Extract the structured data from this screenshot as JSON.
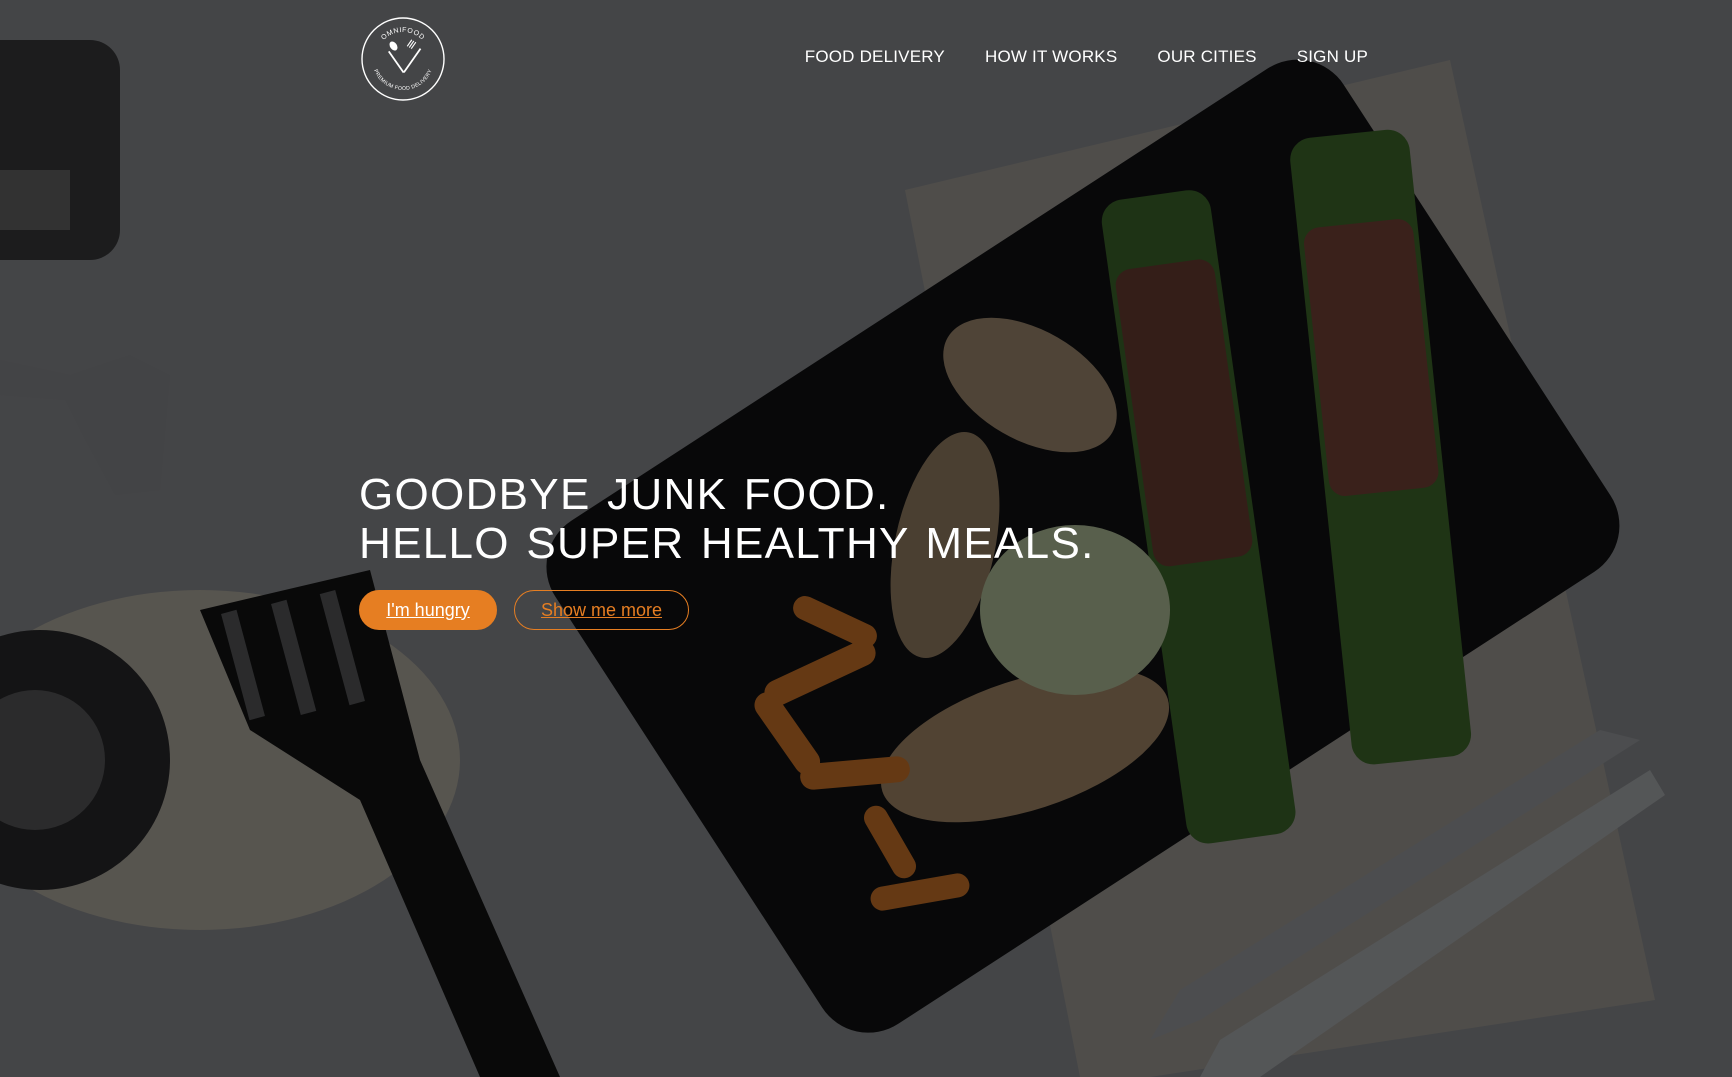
{
  "logo": {
    "brand_top": "OMNIFOOD",
    "brand_bottom": "PREMIUM FOOD DELIVERY",
    "icon": "spoon-fork-crossed-icon"
  },
  "nav": {
    "items": [
      {
        "label": "FOOD DELIVERY"
      },
      {
        "label": "HOW IT WORKS"
      },
      {
        "label": "OUR CITIES"
      },
      {
        "label": "SIGN UP"
      }
    ]
  },
  "hero": {
    "headline_line1": "GOODBYE JUNK FOOD.",
    "headline_line2": "HELLO SUPER HEALTHY MEALS.",
    "primary_button": "I'm hungry",
    "secondary_button": "Show me more"
  },
  "colors": {
    "accent": "#e67e22",
    "text": "#ffffff",
    "overlay": "rgba(0,0,0,0.52)"
  }
}
